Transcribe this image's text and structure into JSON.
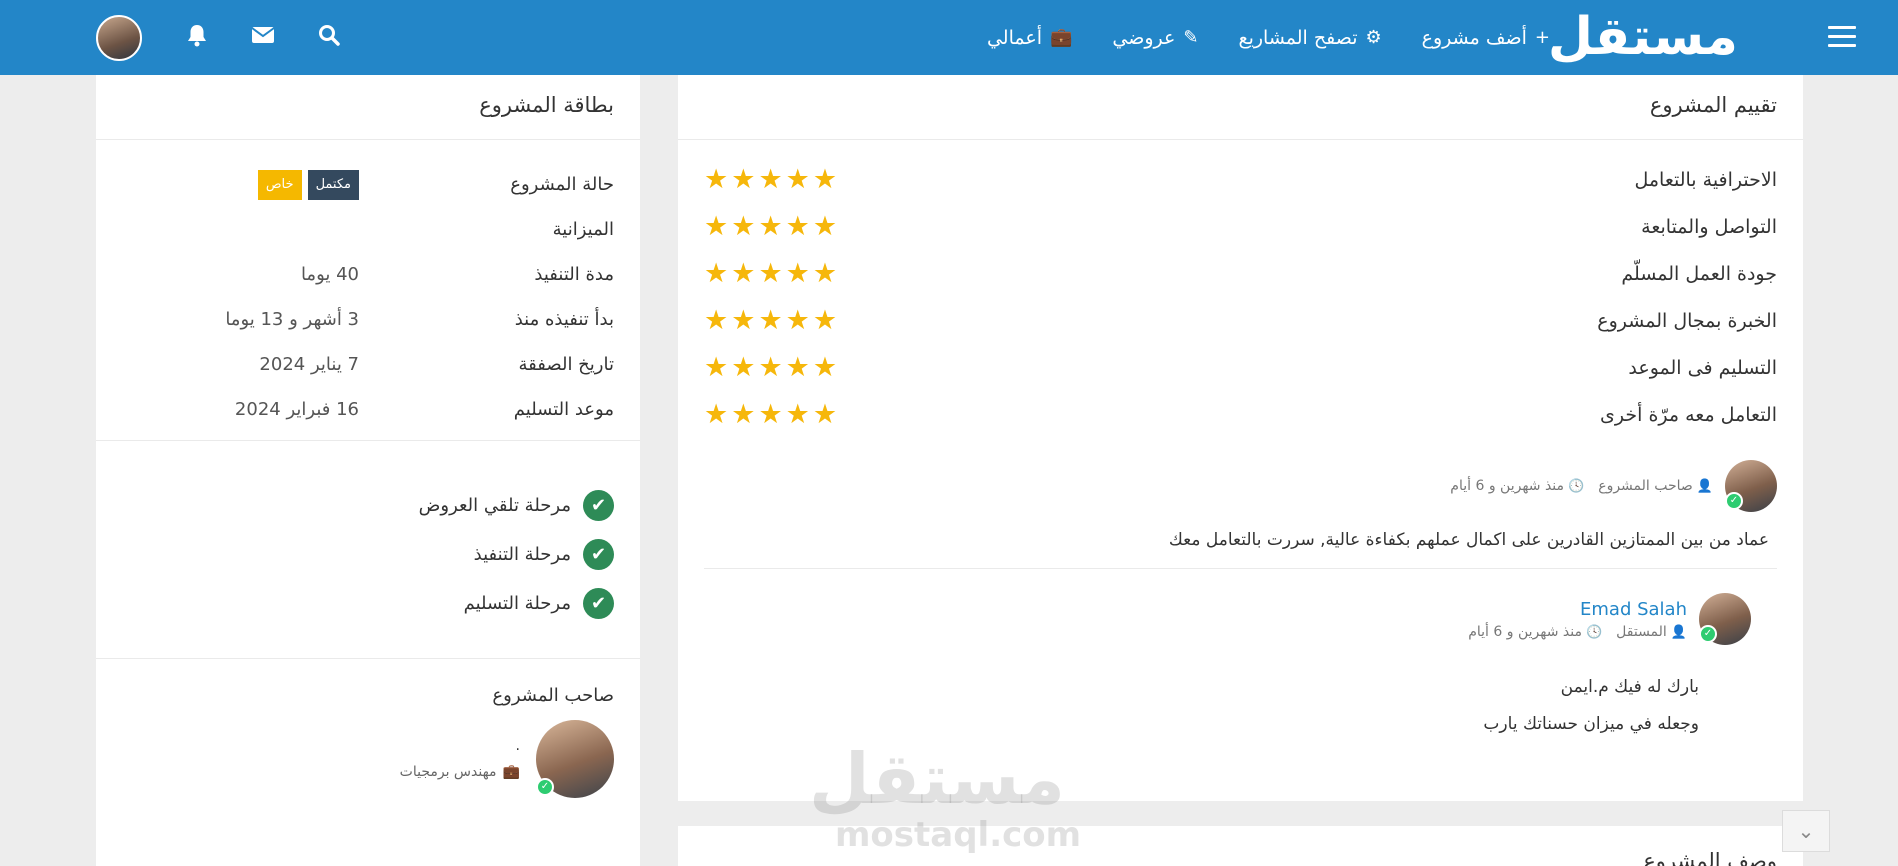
{
  "navbar": {
    "logo": "مستقل",
    "links": [
      {
        "label": "أضف مشروع",
        "icon": "+"
      },
      {
        "label": "تصفح المشاريع",
        "icon": "⚙"
      },
      {
        "label": "عروضي",
        "icon": "✎"
      },
      {
        "label": "أعمالي",
        "icon": "💼"
      }
    ],
    "icons": [
      "search-icon",
      "envelope-icon",
      "bell-icon"
    ]
  },
  "project_card": {
    "title": "بطاقة المشروع",
    "rows": [
      {
        "label": "حالة المشروع",
        "value": ""
      },
      {
        "label": "الميزانية",
        "value": ""
      },
      {
        "label": "مدة التنفيذ",
        "value": "40 يوما"
      },
      {
        "label": "بدأ تنفيذه منذ",
        "value": "3 أشهر و 13 يوما"
      },
      {
        "label": "تاريخ الصفقة",
        "value": "7 يناير 2024"
      },
      {
        "label": "موعد التسليم",
        "value": "16 فبراير 2024"
      }
    ],
    "badges": {
      "status": "مكتمل",
      "type": "خاص"
    },
    "colors": {
      "status_badge": "#34495e",
      "type_badge": "#f5b800"
    },
    "stages": [
      "مرحلة تلقي العروض",
      "مرحلة التنفيذ",
      "مرحلة التسليم"
    ]
  },
  "owner": {
    "title": "صاحب المشروع",
    "name": ".",
    "role": "مهندس برمجيات"
  },
  "rating": {
    "title": "تقييم المشروع",
    "max_stars": 5,
    "criteria": [
      {
        "label": "الاحترافية بالتعامل",
        "stars": 5
      },
      {
        "label": "التواصل والمتابعة",
        "stars": 5
      },
      {
        "label": "جودة العمل المسلّم",
        "stars": 5
      },
      {
        "label": "الخبرة بمجال المشروع",
        "stars": 5
      },
      {
        "label": "التسليم فى الموعد",
        "stars": 5
      },
      {
        "label": "التعامل معه مرّة أخرى",
        "stars": 5
      }
    ]
  },
  "review": {
    "role": "صاحب المشروع",
    "time": "منذ شهرين و 6 أيام",
    "text": "عماد من بين الممتازين القادرين على اكمال عملهم بكفاءة عالية, سررت بالتعامل معك"
  },
  "reply": {
    "name": "Emad Salah",
    "role": "المستقل",
    "time": "منذ شهرين و 6 أيام",
    "lines": [
      "بارك له فيك م.ايمن",
      "وجعله في ميزان حسناتك يارب"
    ]
  },
  "bottom_section": {
    "title": "وصف المشروع"
  },
  "watermark": {
    "logo": "مستقل",
    "url": "mostaql.com"
  },
  "colors": {
    "brand": "#2386c8",
    "star": "#f6b70b",
    "check": "#2e8b57"
  }
}
